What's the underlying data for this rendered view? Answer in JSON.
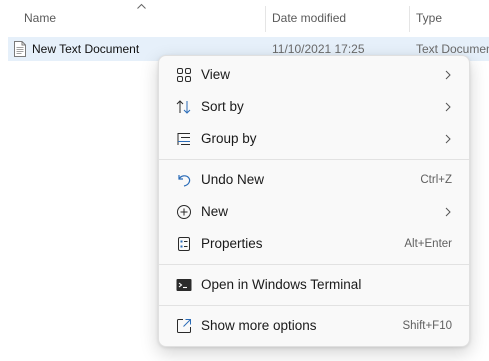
{
  "columns": {
    "name": "Name",
    "date_modified": "Date modified",
    "type": "Type"
  },
  "file": {
    "name": "New Text Document",
    "date": "11/10/2021 17:25",
    "type": "Text Document"
  },
  "context_menu": {
    "items": [
      {
        "label": "View",
        "icon": "view-grid-icon",
        "submenu": true
      },
      {
        "label": "Sort by",
        "icon": "sort-icon",
        "submenu": true
      },
      {
        "label": "Group by",
        "icon": "group-icon",
        "submenu": true
      },
      {
        "label": "Undo New",
        "icon": "undo-icon",
        "shortcut": "Ctrl+Z"
      },
      {
        "label": "New",
        "icon": "plus-circle-icon",
        "submenu": true
      },
      {
        "label": "Properties",
        "icon": "properties-icon",
        "shortcut": "Alt+Enter"
      },
      {
        "label": "Open in Windows Terminal",
        "icon": "terminal-icon"
      },
      {
        "label": "Show more options",
        "icon": "more-options-icon",
        "shortcut": "Shift+F10"
      }
    ]
  },
  "colors": {
    "selection": "#e6f0fa",
    "menu_bg": "#f9f9f9",
    "accent": "#2b6cb8"
  }
}
